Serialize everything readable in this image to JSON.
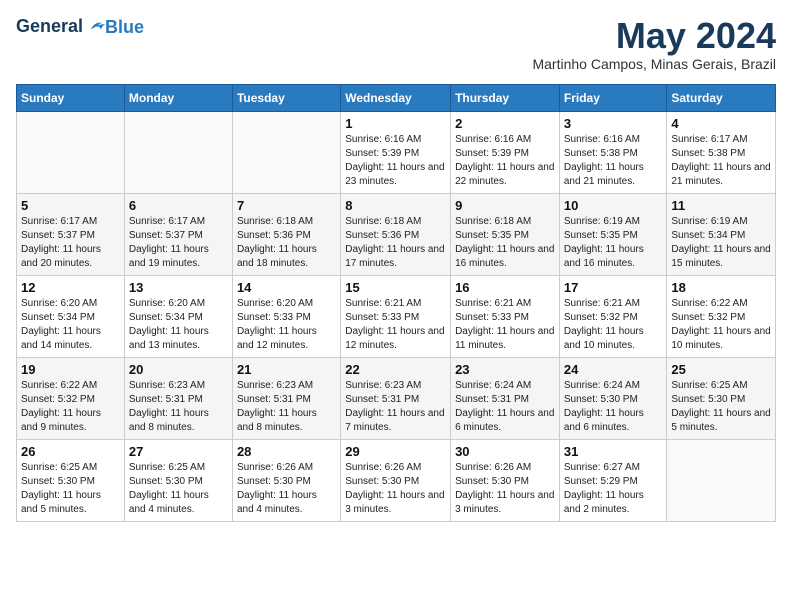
{
  "logo": {
    "line1": "General",
    "line2": "Blue"
  },
  "title": "May 2024",
  "location": "Martinho Campos, Minas Gerais, Brazil",
  "weekdays": [
    "Sunday",
    "Monday",
    "Tuesday",
    "Wednesday",
    "Thursday",
    "Friday",
    "Saturday"
  ],
  "weeks": [
    [
      {
        "day": "",
        "info": ""
      },
      {
        "day": "",
        "info": ""
      },
      {
        "day": "",
        "info": ""
      },
      {
        "day": "1",
        "info": "Sunrise: 6:16 AM\nSunset: 5:39 PM\nDaylight: 11 hours and 23 minutes."
      },
      {
        "day": "2",
        "info": "Sunrise: 6:16 AM\nSunset: 5:39 PM\nDaylight: 11 hours and 22 minutes."
      },
      {
        "day": "3",
        "info": "Sunrise: 6:16 AM\nSunset: 5:38 PM\nDaylight: 11 hours and 21 minutes."
      },
      {
        "day": "4",
        "info": "Sunrise: 6:17 AM\nSunset: 5:38 PM\nDaylight: 11 hours and 21 minutes."
      }
    ],
    [
      {
        "day": "5",
        "info": "Sunrise: 6:17 AM\nSunset: 5:37 PM\nDaylight: 11 hours and 20 minutes."
      },
      {
        "day": "6",
        "info": "Sunrise: 6:17 AM\nSunset: 5:37 PM\nDaylight: 11 hours and 19 minutes."
      },
      {
        "day": "7",
        "info": "Sunrise: 6:18 AM\nSunset: 5:36 PM\nDaylight: 11 hours and 18 minutes."
      },
      {
        "day": "8",
        "info": "Sunrise: 6:18 AM\nSunset: 5:36 PM\nDaylight: 11 hours and 17 minutes."
      },
      {
        "day": "9",
        "info": "Sunrise: 6:18 AM\nSunset: 5:35 PM\nDaylight: 11 hours and 16 minutes."
      },
      {
        "day": "10",
        "info": "Sunrise: 6:19 AM\nSunset: 5:35 PM\nDaylight: 11 hours and 16 minutes."
      },
      {
        "day": "11",
        "info": "Sunrise: 6:19 AM\nSunset: 5:34 PM\nDaylight: 11 hours and 15 minutes."
      }
    ],
    [
      {
        "day": "12",
        "info": "Sunrise: 6:20 AM\nSunset: 5:34 PM\nDaylight: 11 hours and 14 minutes."
      },
      {
        "day": "13",
        "info": "Sunrise: 6:20 AM\nSunset: 5:34 PM\nDaylight: 11 hours and 13 minutes."
      },
      {
        "day": "14",
        "info": "Sunrise: 6:20 AM\nSunset: 5:33 PM\nDaylight: 11 hours and 12 minutes."
      },
      {
        "day": "15",
        "info": "Sunrise: 6:21 AM\nSunset: 5:33 PM\nDaylight: 11 hours and 12 minutes."
      },
      {
        "day": "16",
        "info": "Sunrise: 6:21 AM\nSunset: 5:33 PM\nDaylight: 11 hours and 11 minutes."
      },
      {
        "day": "17",
        "info": "Sunrise: 6:21 AM\nSunset: 5:32 PM\nDaylight: 11 hours and 10 minutes."
      },
      {
        "day": "18",
        "info": "Sunrise: 6:22 AM\nSunset: 5:32 PM\nDaylight: 11 hours and 10 minutes."
      }
    ],
    [
      {
        "day": "19",
        "info": "Sunrise: 6:22 AM\nSunset: 5:32 PM\nDaylight: 11 hours and 9 minutes."
      },
      {
        "day": "20",
        "info": "Sunrise: 6:23 AM\nSunset: 5:31 PM\nDaylight: 11 hours and 8 minutes."
      },
      {
        "day": "21",
        "info": "Sunrise: 6:23 AM\nSunset: 5:31 PM\nDaylight: 11 hours and 8 minutes."
      },
      {
        "day": "22",
        "info": "Sunrise: 6:23 AM\nSunset: 5:31 PM\nDaylight: 11 hours and 7 minutes."
      },
      {
        "day": "23",
        "info": "Sunrise: 6:24 AM\nSunset: 5:31 PM\nDaylight: 11 hours and 6 minutes."
      },
      {
        "day": "24",
        "info": "Sunrise: 6:24 AM\nSunset: 5:30 PM\nDaylight: 11 hours and 6 minutes."
      },
      {
        "day": "25",
        "info": "Sunrise: 6:25 AM\nSunset: 5:30 PM\nDaylight: 11 hours and 5 minutes."
      }
    ],
    [
      {
        "day": "26",
        "info": "Sunrise: 6:25 AM\nSunset: 5:30 PM\nDaylight: 11 hours and 5 minutes."
      },
      {
        "day": "27",
        "info": "Sunrise: 6:25 AM\nSunset: 5:30 PM\nDaylight: 11 hours and 4 minutes."
      },
      {
        "day": "28",
        "info": "Sunrise: 6:26 AM\nSunset: 5:30 PM\nDaylight: 11 hours and 4 minutes."
      },
      {
        "day": "29",
        "info": "Sunrise: 6:26 AM\nSunset: 5:30 PM\nDaylight: 11 hours and 3 minutes."
      },
      {
        "day": "30",
        "info": "Sunrise: 6:26 AM\nSunset: 5:30 PM\nDaylight: 11 hours and 3 minutes."
      },
      {
        "day": "31",
        "info": "Sunrise: 6:27 AM\nSunset: 5:29 PM\nDaylight: 11 hours and 2 minutes."
      },
      {
        "day": "",
        "info": ""
      }
    ]
  ]
}
